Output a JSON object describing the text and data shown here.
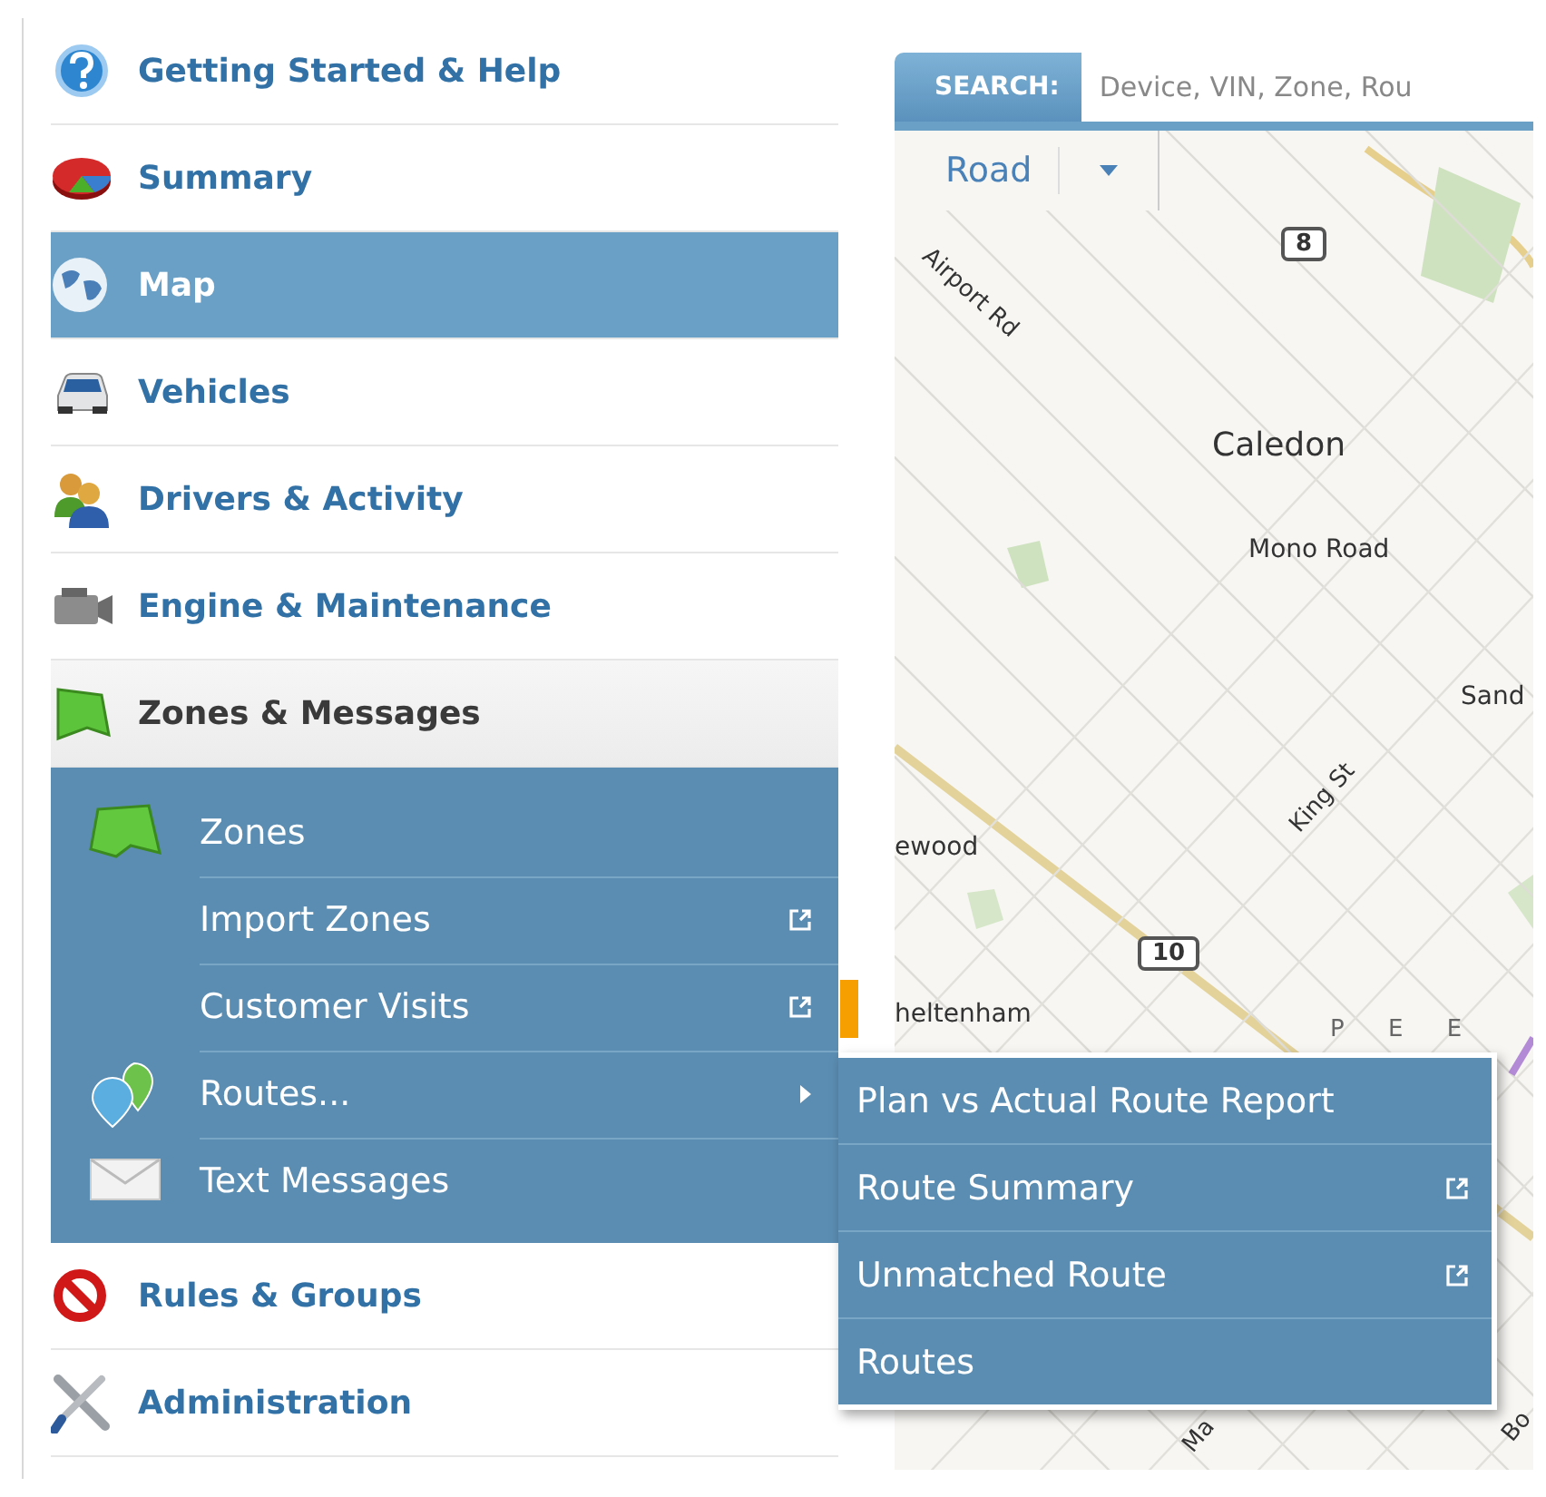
{
  "nav": {
    "items": [
      {
        "label": "Getting Started & Help",
        "selected": false,
        "expanded": false
      },
      {
        "label": "Summary",
        "selected": false,
        "expanded": false
      },
      {
        "label": "Map",
        "selected": true,
        "expanded": false
      },
      {
        "label": "Vehicles",
        "selected": false,
        "expanded": false
      },
      {
        "label": "Drivers & Activity",
        "selected": false,
        "expanded": false
      },
      {
        "label": "Engine & Maintenance",
        "selected": false,
        "expanded": false
      },
      {
        "label": "Zones & Messages",
        "selected": false,
        "expanded": true,
        "children": [
          {
            "label": "Zones",
            "external": false,
            "expanded": false
          },
          {
            "label": "Import Zones",
            "external": true,
            "expanded": false
          },
          {
            "label": "Customer Visits",
            "external": true,
            "expanded": false
          },
          {
            "label": "Routes...",
            "external": false,
            "expanded": true,
            "children": [
              {
                "label": "Plan vs Actual Route Report",
                "external": false
              },
              {
                "label": "Route Summary",
                "external": true
              },
              {
                "label": "Unmatched Route",
                "external": true
              },
              {
                "label": "Routes",
                "external": false
              }
            ]
          },
          {
            "label": "Text Messages",
            "external": false,
            "expanded": false
          }
        ]
      },
      {
        "label": "Rules & Groups",
        "selected": false,
        "expanded": false
      },
      {
        "label": "Administration",
        "selected": false,
        "expanded": false
      }
    ]
  },
  "map": {
    "search": {
      "label": "SEARCH:",
      "placeholder": "Device, VIN, Zone, Rou"
    },
    "map_type": {
      "label": "Road"
    },
    "labels": [
      {
        "text": "Airport Rd",
        "kind": "road"
      },
      {
        "text": "8",
        "kind": "shield"
      },
      {
        "text": "Caledon",
        "kind": "town"
      },
      {
        "text": "Mono Road",
        "kind": "place"
      },
      {
        "text": "Sand",
        "kind": "place"
      },
      {
        "text": "ewood",
        "kind": "place"
      },
      {
        "text": "King St",
        "kind": "road"
      },
      {
        "text": "10",
        "kind": "shield"
      },
      {
        "text": "heltenham",
        "kind": "place"
      },
      {
        "text": "P E E",
        "kind": "region"
      },
      {
        "text": "Ma",
        "kind": "road"
      },
      {
        "text": "Bo",
        "kind": "road"
      }
    ]
  }
}
